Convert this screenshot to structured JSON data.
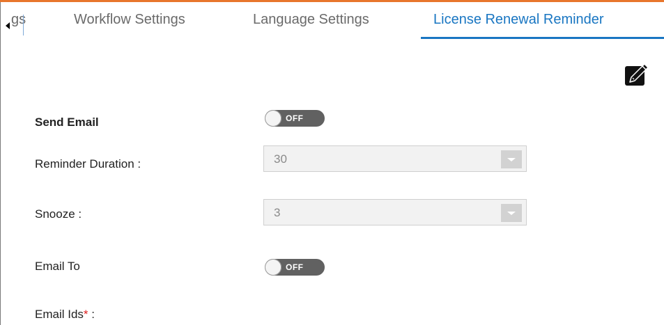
{
  "tabs": [
    {
      "label": "gs",
      "active": false
    },
    {
      "label": "Workflow Settings",
      "active": false
    },
    {
      "label": "Language Settings",
      "active": false
    },
    {
      "label": "License Renewal Reminder",
      "active": true
    }
  ],
  "form": {
    "send_email": {
      "label": "Send Email",
      "toggle": "OFF"
    },
    "reminder_duration": {
      "label": "Reminder Duration :",
      "value": "30"
    },
    "snooze": {
      "label": "Snooze :",
      "value": "3"
    },
    "email_to": {
      "label": "Email To",
      "toggle": "OFF"
    },
    "email_ids": {
      "label": "Email Ids",
      "required_mark": "*",
      "suffix": " :"
    }
  },
  "icons": {
    "scroll_left": "caret-left-icon",
    "edit": "pencil-edit-icon"
  },
  "colors": {
    "accent_top": "#e8762c",
    "active_tab": "#1976c2",
    "toggle_off": "#616161",
    "required": "#e02020"
  }
}
